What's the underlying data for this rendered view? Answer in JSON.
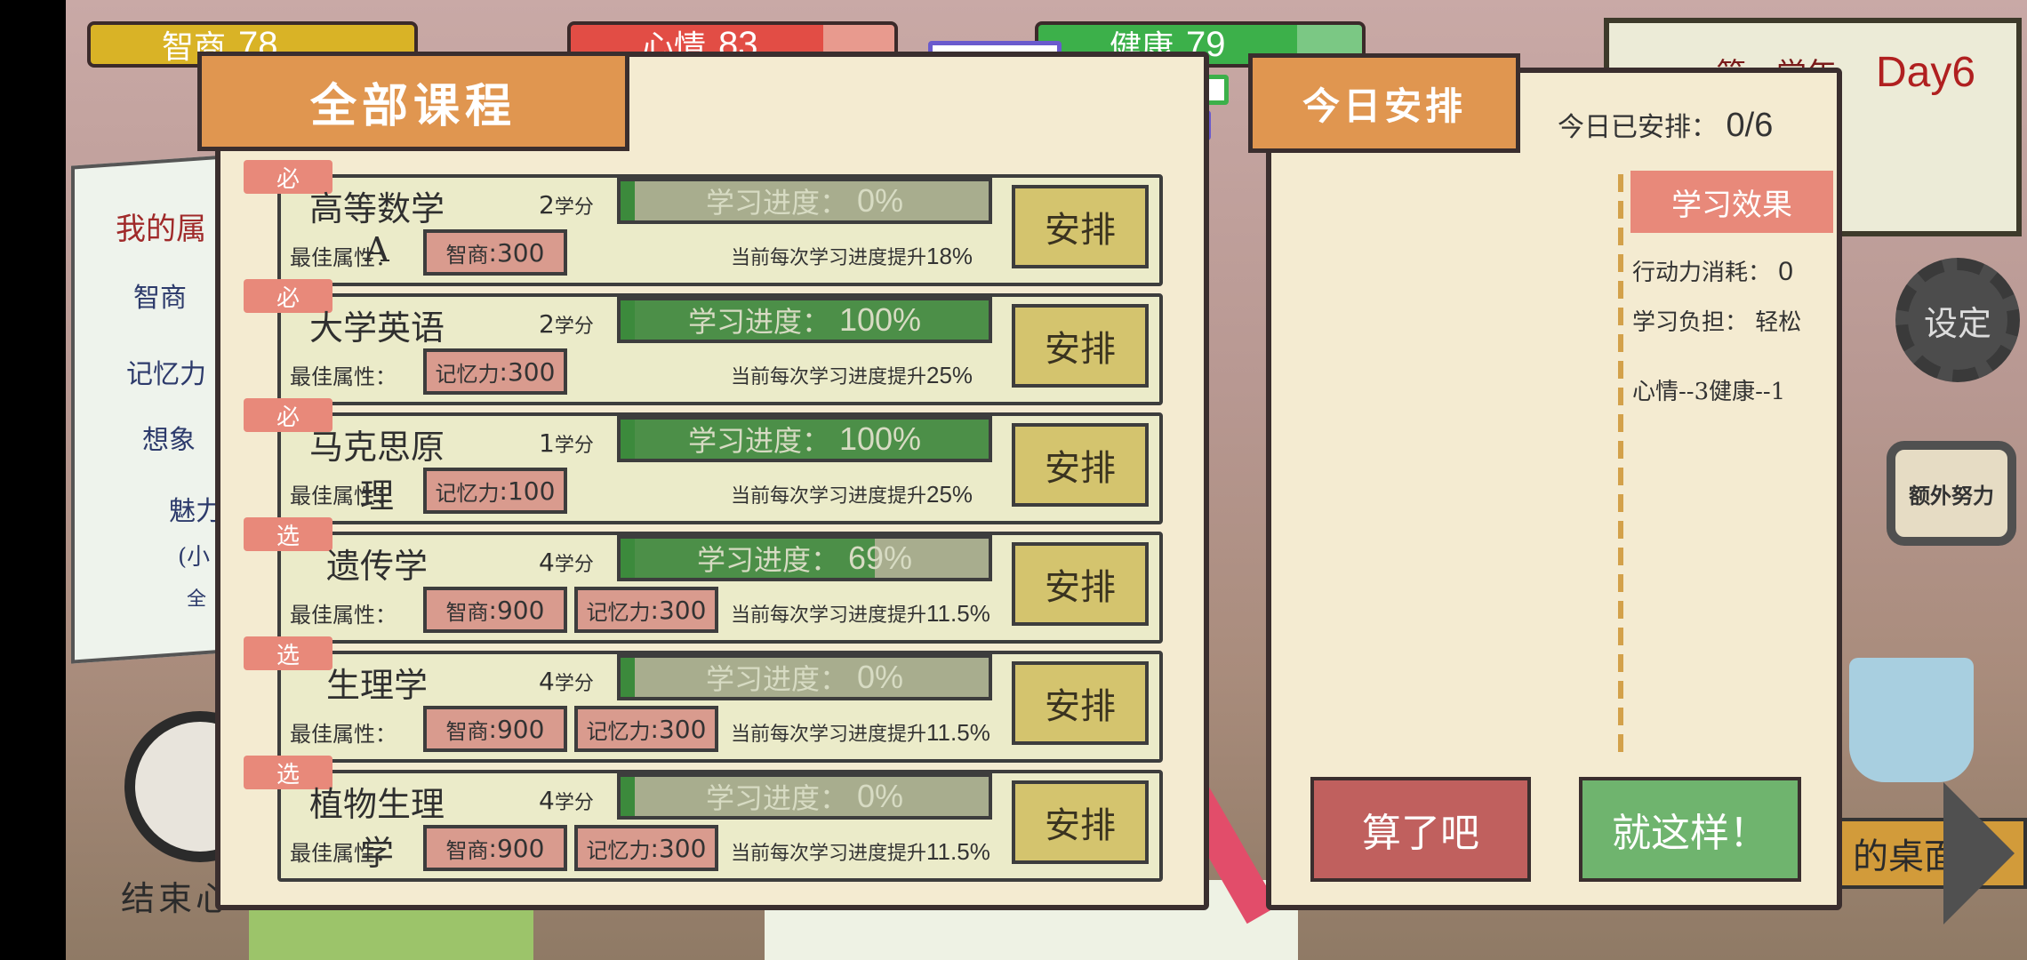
{
  "stats": {
    "intelligence": {
      "label": "智商",
      "value": "78"
    },
    "mood": {
      "label": "心情",
      "value": "83"
    },
    "health": {
      "label": "健康",
      "value": "79"
    }
  },
  "year_card": {
    "term": "第一学年",
    "day": "Day6"
  },
  "settings_label": "设定",
  "extra_label": "额外努力",
  "desk_label": "的桌面",
  "end_label": "结束心",
  "note": {
    "title": "我的属",
    "lines": [
      "智商",
      "记忆力",
      "想象",
      "魅力",
      "(小",
      "全"
    ]
  },
  "courses_panel": {
    "title": "全部课程",
    "best_label": "最佳属性：",
    "progress_label": "学习进度：",
    "boost_label": "当前每次学习进度提升",
    "arrange_label": "安排",
    "courses": [
      {
        "tag": "必",
        "name": "高等数学A",
        "credits": "2",
        "credit_unit": "学分",
        "progress": "0%",
        "progress_value": 0,
        "attrs": [
          {
            "name": "智商",
            "value": ":300"
          }
        ],
        "boost": "18%"
      },
      {
        "tag": "必",
        "name": "大学英语",
        "credits": "2",
        "credit_unit": "学分",
        "progress": "100%",
        "progress_value": 100,
        "attrs": [
          {
            "name": "记忆力",
            "value": ":300"
          }
        ],
        "boost": "25%"
      },
      {
        "tag": "必",
        "name": "马克思原理",
        "credits": "1",
        "credit_unit": "学分",
        "progress": "100%",
        "progress_value": 100,
        "attrs": [
          {
            "name": "记忆力",
            "value": ":100"
          }
        ],
        "boost": "25%"
      },
      {
        "tag": "选",
        "name": "遗传学",
        "credits": "4",
        "credit_unit": "学分",
        "progress": "69%",
        "progress_value": 69,
        "attrs": [
          {
            "name": "智商",
            "value": ":900"
          },
          {
            "name": "记忆力",
            "value": ":300"
          }
        ],
        "boost": "11.5%"
      },
      {
        "tag": "选",
        "name": "生理学",
        "credits": "4",
        "credit_unit": "学分",
        "progress": "0%",
        "progress_value": 0,
        "attrs": [
          {
            "name": "智商",
            "value": ":900"
          },
          {
            "name": "记忆力",
            "value": ":300"
          }
        ],
        "boost": "11.5%"
      },
      {
        "tag": "选",
        "name": "植物生理学",
        "credits": "4",
        "credit_unit": "学分",
        "progress": "0%",
        "progress_value": 0,
        "attrs": [
          {
            "name": "智商",
            "value": ":900"
          },
          {
            "name": "记忆力",
            "value": ":300"
          }
        ],
        "boost": "11.5%"
      }
    ]
  },
  "today_panel": {
    "title": "今日安排",
    "count_label": "今日已安排：",
    "count_value": "0/6",
    "effect_title": "学习效果",
    "action_label": "行动力消耗：",
    "action_value": "0",
    "burden_label": "学习负担：",
    "burden_value": "轻松",
    "mood_health": "心情--3健康--1",
    "cancel_label": "算了吧",
    "confirm_label": "就这样！"
  },
  "colors": {
    "panel_bg": "#f4ebd1",
    "tab_orange": "#e09650",
    "arrange_yellow": "#d4c46e",
    "tag_red": "#e8897a",
    "progress_green": "#3c8a3c"
  }
}
